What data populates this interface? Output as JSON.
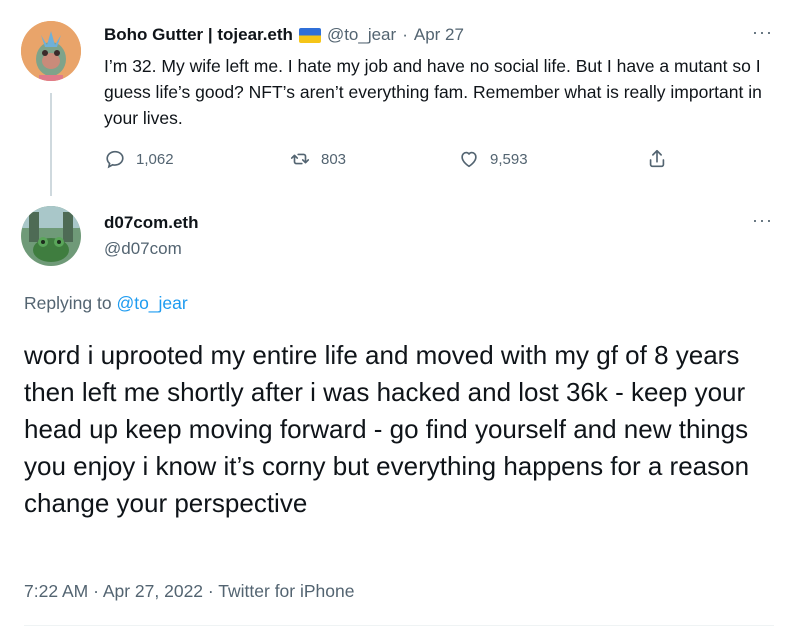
{
  "parent_tweet": {
    "display_name": "Boho Gutter | tojear.eth",
    "handle": "@to_jear",
    "separator": "·",
    "date": "Apr 27",
    "text": "I’m 32. My wife left me. I hate my job and have no social life. But I have a mutant so I guess life’s good? NFT’s aren’t everything fam. Remember what is really important in your lives.",
    "actions": {
      "replies": "1,062",
      "retweets": "803",
      "likes": "9,593"
    },
    "flag_icon": "ukraine-flag-icon"
  },
  "main_tweet": {
    "display_name": "d07com.eth",
    "handle": "@d07com",
    "replying_prefix": "Replying to",
    "replying_to": "@to_jear",
    "text": "word i uprooted my entire life and moved with my gf of 8 years then left me shortly after i was hacked and lost 36k - keep your head up keep moving forward - go find yourself and new things you enjoy i know it’s corny but everything happens for a reason change your perspective",
    "time": "7:22 AM",
    "separator1": "·",
    "date": "Apr 27, 2022",
    "separator2": "·",
    "source": "Twitter for iPhone"
  },
  "more_label": "···",
  "colors": {
    "link": "#1d9bf0",
    "muted": "#536471",
    "text": "#0f1419"
  }
}
